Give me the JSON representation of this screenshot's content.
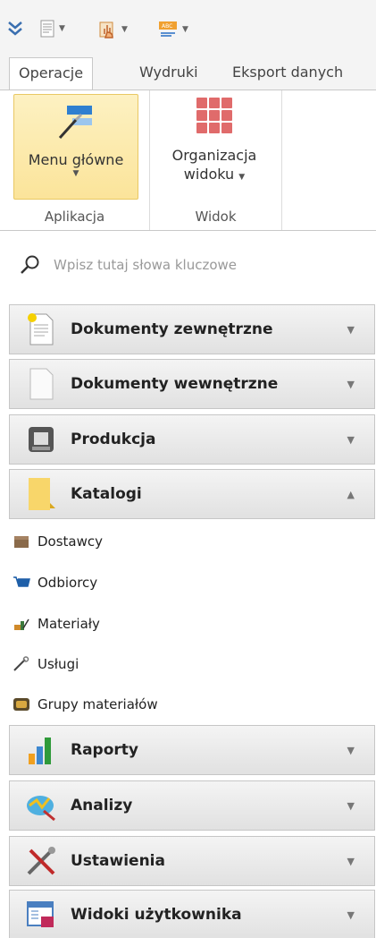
{
  "tabs": [
    {
      "label": "Operacje"
    },
    {
      "label": "Wydruki"
    },
    {
      "label": "Eksport danych"
    }
  ],
  "ribbon": {
    "groups": [
      {
        "label": "Aplikacja",
        "button": {
          "label": "Menu główne"
        }
      },
      {
        "label": "Widok",
        "button": {
          "label_line1": "Organizacja",
          "label_line2": "widoku"
        }
      }
    ]
  },
  "search": {
    "placeholder": "Wpisz tutaj słowa kluczowe"
  },
  "nav": {
    "sections": [
      {
        "label": "Dokumenty zewnętrzne",
        "icon": "document-star-icon",
        "expanded": false
      },
      {
        "label": "Dokumenty wewnętrzne",
        "icon": "document-icon",
        "expanded": false
      },
      {
        "label": "Produkcja",
        "icon": "machine-icon",
        "expanded": false
      },
      {
        "label": "Katalogi",
        "icon": "folder-icon",
        "expanded": true
      },
      {
        "label": "Raporty",
        "icon": "bar-chart-icon",
        "expanded": false
      },
      {
        "label": "Analizy",
        "icon": "analysis-icon",
        "expanded": false
      },
      {
        "label": "Ustawienia",
        "icon": "tools-icon",
        "expanded": false
      },
      {
        "label": "Widoki użytkownika",
        "icon": "calendar-view-icon",
        "expanded": false
      }
    ],
    "katalogi_items": [
      {
        "label": "Dostawcy",
        "icon": "box-icon"
      },
      {
        "label": "Odbiorcy",
        "icon": "cart-icon"
      },
      {
        "label": "Materiały",
        "icon": "materials-icon"
      },
      {
        "label": "Usługi",
        "icon": "wrench-icon"
      },
      {
        "label": "Grupy materiałów",
        "icon": "box-group-icon"
      }
    ]
  }
}
